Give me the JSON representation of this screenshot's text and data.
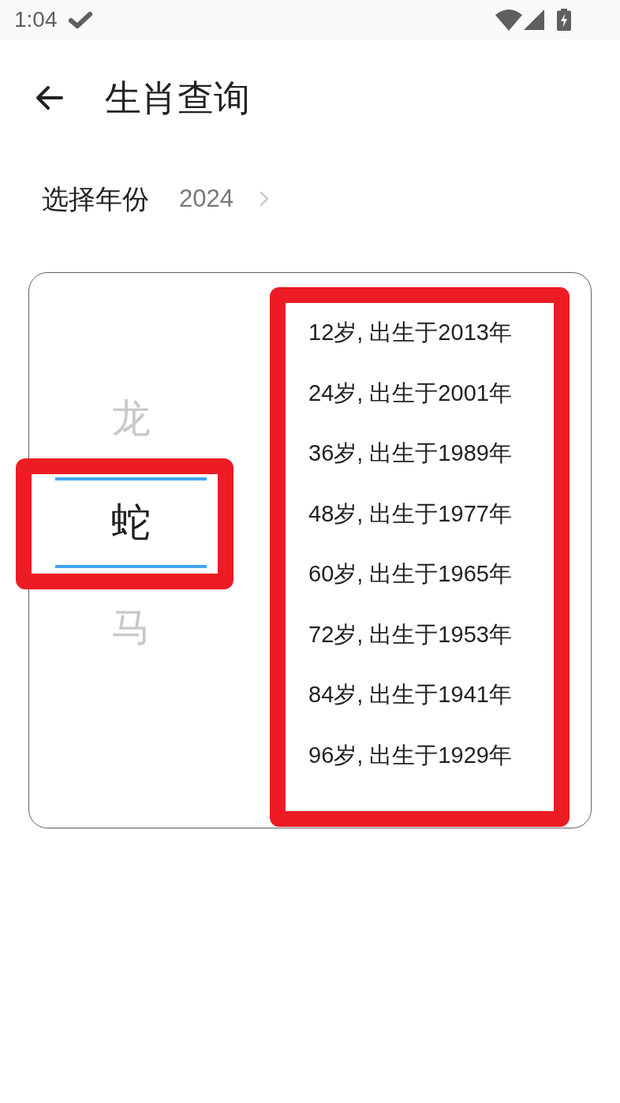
{
  "status_bar": {
    "time": "1:04"
  },
  "header": {
    "title": "生肖查询"
  },
  "year_selector": {
    "label": "选择年份",
    "value": "2024"
  },
  "zodiac_picker": {
    "highlighted": true,
    "options": [
      {
        "label": "龙",
        "selected": false
      },
      {
        "label": "蛇",
        "selected": true
      },
      {
        "label": "马",
        "selected": false
      }
    ]
  },
  "age_list": {
    "highlighted": true,
    "items": [
      "12岁, 出生于2013年",
      "24岁, 出生于2001年",
      "36岁, 出生于1989年",
      "48岁, 出生于1977年",
      "60岁, 出生于1965年",
      "72岁, 出生于1953年",
      "84岁, 出生于1941年",
      "96岁, 出生于1929年"
    ]
  }
}
